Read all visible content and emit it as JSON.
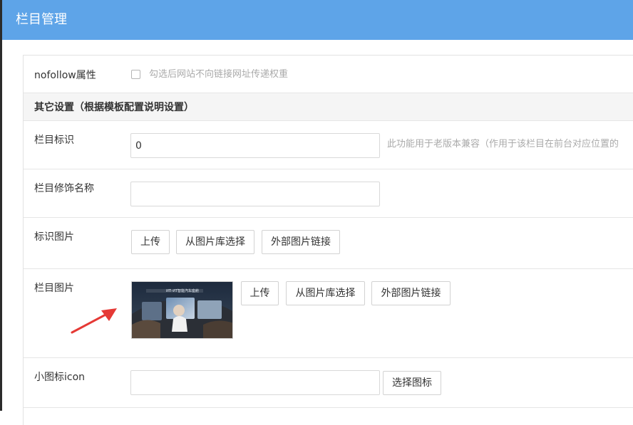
{
  "header": {
    "title": "栏目管理"
  },
  "form": {
    "nofollow": {
      "label": "nofollow属性",
      "checked": false,
      "hint": "勾选后网站不向链接网址传递权重"
    },
    "section_other": {
      "title": "其它设置（根据模板配置说明设置）"
    },
    "column_id": {
      "label": "栏目标识",
      "value": "0",
      "hint": "此功能用于老版本兼容（作用于该栏目在前台对应位置的"
    },
    "column_decor_name": {
      "label": "栏目修饰名称",
      "value": ""
    },
    "logo_image": {
      "label": "标识图片",
      "upload_label": "上传",
      "library_label": "从图片库选择",
      "external_label": "外部图片链接"
    },
    "column_image": {
      "label": "栏目图片",
      "thumbnail_caption": "ИП-ИТ智能汽车座舱",
      "upload_label": "上传",
      "library_label": "从图片库选择",
      "external_label": "外部图片链接"
    },
    "small_icon": {
      "label": "小图标icon",
      "value": "",
      "choose_label": "选择图标"
    }
  },
  "colors": {
    "header_bg": "#5ea4e8",
    "arrow": "#e53935",
    "hint_text": "#aaaaaa"
  },
  "icons": {
    "annotation": "red-arrow-icon"
  }
}
